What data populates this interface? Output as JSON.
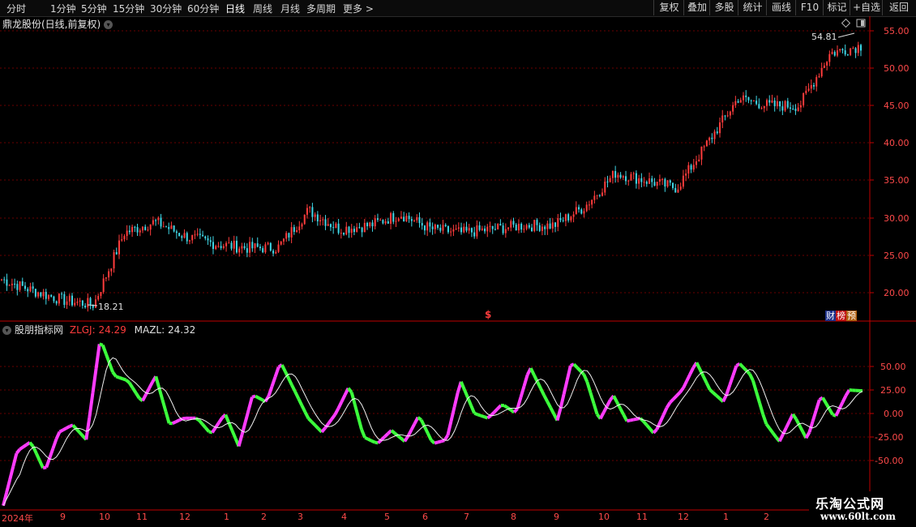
{
  "toolbar": {
    "left": [
      "分时",
      "1分钟",
      "5分钟",
      "15分钟",
      "30分钟",
      "60分钟",
      "日线",
      "周线",
      "月线",
      "多周期",
      "更多 >"
    ],
    "right": [
      "复权",
      "叠加",
      "多股",
      "统计",
      "画线",
      "F10",
      "标记",
      "+自选",
      "返回"
    ]
  },
  "main": {
    "title": "鼎龙股份(日线,前复权)",
    "high_label": "54.81",
    "low_label": "18.21",
    "price_axis": [
      "55.00",
      "50.00",
      "45.00",
      "40.00",
      "35.00",
      "30.00",
      "25.00",
      "20.00"
    ],
    "badge_cai": "财",
    "badge_bang": "榜",
    "badge_yu": "预",
    "event_marker": "$"
  },
  "indicator": {
    "name": "股朋指标网",
    "zlgj_label": "ZLGJ: 24.29",
    "mazl_label": "MAZL: 24.32",
    "axis": [
      "50.00",
      "25.00",
      "0.00",
      "-25.00",
      "-50.00"
    ]
  },
  "x_axis": [
    "2024年",
    "9",
    "10",
    "11",
    "12",
    "1",
    "2",
    "3",
    "4",
    "5",
    "6",
    "7",
    "8",
    "9",
    "10",
    "11",
    "12",
    "1",
    "2"
  ],
  "watermark": {
    "line1": "乐淘公式网",
    "line2": "www.60lt.com"
  },
  "colors": {
    "up": "#ff3c3c",
    "down": "#3fd6e6",
    "ind_up": "#ff3cff",
    "ind_down": "#3cff3c",
    "grid": "#7a0000",
    "axis_text": "#ff4a4a"
  },
  "chart_data": [
    {
      "type": "candlestick",
      "title": "鼎龙股份(日线,前复权)",
      "ylim": [
        17,
        57
      ],
      "y_ticks": [
        20,
        25,
        30,
        35,
        40,
        45,
        50,
        55
      ],
      "annotations": [
        {
          "text": "54.81",
          "value": 54.81
        },
        {
          "text": "18.21",
          "value": 18.21
        }
      ],
      "x": [
        "2024年",
        "9",
        "10",
        "11",
        "12",
        "1",
        "2",
        "3",
        "4",
        "5",
        "6",
        "7",
        "8",
        "9",
        "10",
        "11",
        "12",
        "1",
        "2"
      ],
      "close_approx": [
        21.8,
        20.3,
        19.0,
        18.4,
        28.0,
        29.5,
        27.5,
        26.5,
        26.0,
        26.0,
        31.0,
        28.5,
        29.0,
        30.5,
        28.5,
        28.0,
        28.5,
        29.0,
        29.0,
        31.5,
        36.0,
        35.0,
        34.0,
        40.0,
        46.0,
        45.0,
        45.0,
        52.0,
        53.0
      ]
    },
    {
      "type": "line",
      "series": [
        {
          "name": "ZLGJ"
        },
        {
          "name": "MAZL"
        }
      ],
      "ylim": [
        -75,
        85
      ],
      "y_ticks": [
        50,
        25,
        0,
        -25,
        -50
      ],
      "last_values": {
        "ZLGJ": 24.29,
        "MAZL": 24.32
      },
      "zlgj_values": [
        -98,
        -40,
        -30,
        -62,
        -20,
        -12,
        -28,
        80,
        40,
        35,
        12,
        40,
        -12,
        -5,
        -5,
        -22,
        0,
        -35,
        20,
        12,
        55,
        25,
        -5,
        -20,
        0,
        30,
        -25,
        -32,
        -18,
        -30,
        -2,
        -32,
        -28,
        35,
        0,
        -5,
        10,
        0,
        50,
        20,
        -8,
        55,
        40,
        -8,
        20,
        -8,
        -5,
        -22,
        10,
        25,
        55,
        25,
        12,
        55,
        40,
        -10,
        -30,
        0,
        -28,
        20,
        -5,
        25,
        24
      ]
    }
  ]
}
